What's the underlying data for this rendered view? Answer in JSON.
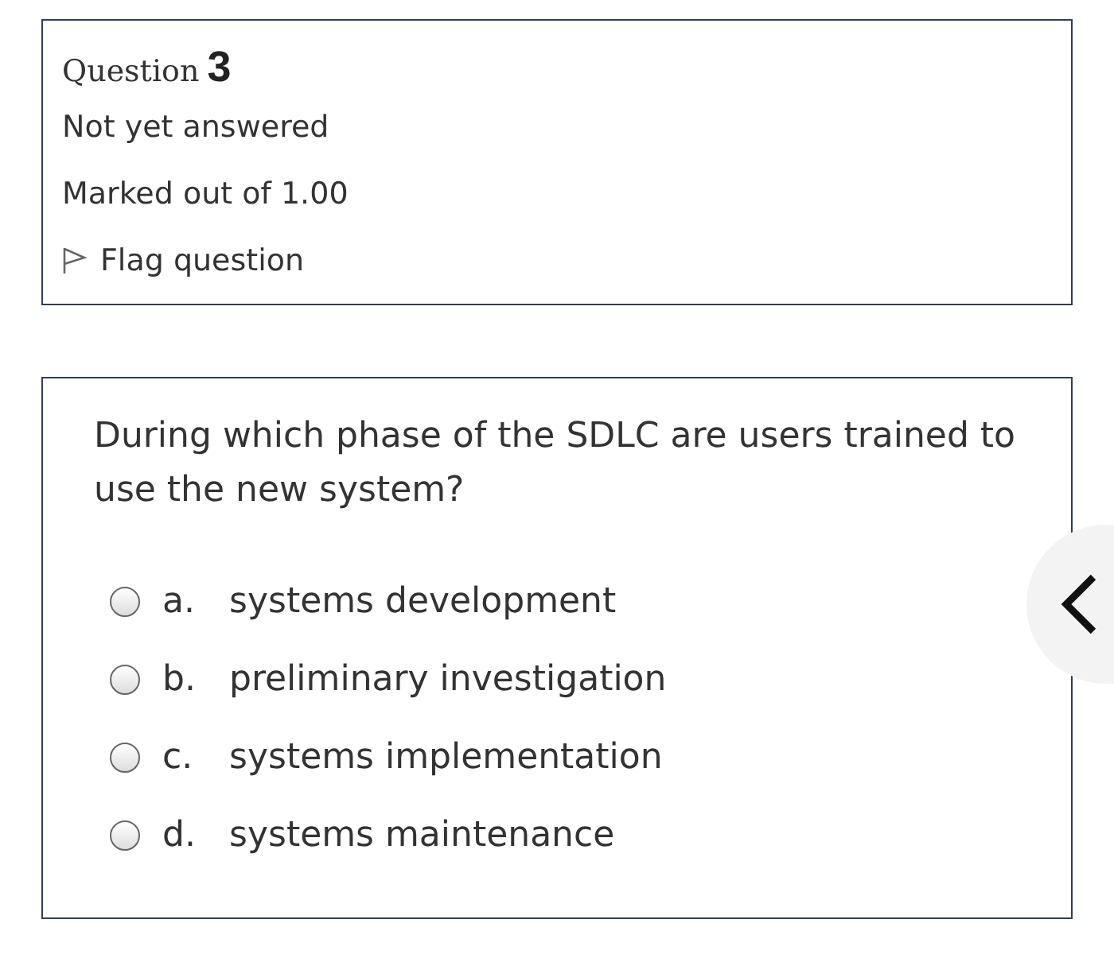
{
  "info": {
    "question_label": "Question",
    "question_number": "3",
    "status": "Not yet answered",
    "marks": "Marked out of 1.00",
    "flag": {
      "label": "Flag question",
      "flagged": false
    }
  },
  "question": {
    "text": "During which phase of the SDLC are users trained to use the new system?",
    "options": [
      {
        "letter": "a.",
        "text": "systems development",
        "selected": false
      },
      {
        "letter": "b.",
        "text": "preliminary investigation",
        "selected": false
      },
      {
        "letter": "c.",
        "text": "systems implementation",
        "selected": false
      },
      {
        "letter": "d.",
        "text": "systems maintenance",
        "selected": false
      }
    ]
  }
}
